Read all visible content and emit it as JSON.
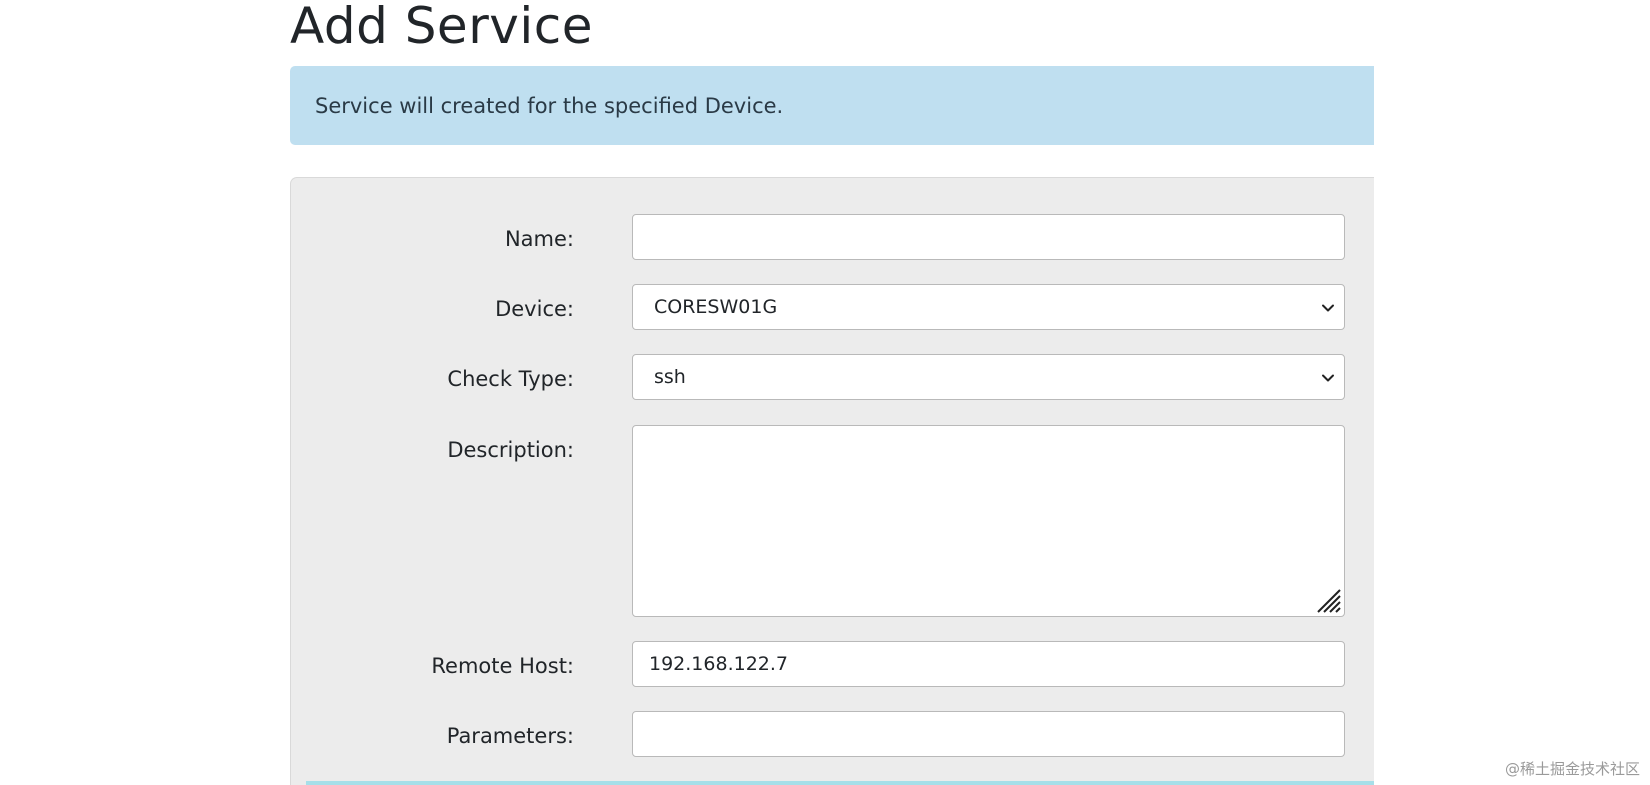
{
  "page": {
    "title": "Add Service",
    "info_message": "Service will created for the specified Device."
  },
  "form": {
    "name": {
      "label": "Name:",
      "value": ""
    },
    "device": {
      "label": "Device:",
      "selected": "CORESW01G"
    },
    "check_type": {
      "label": "Check Type:",
      "selected": "ssh"
    },
    "description": {
      "label": "Description:",
      "value": ""
    },
    "remote_host": {
      "label": "Remote Host:",
      "value": "192.168.122.7"
    },
    "parameters": {
      "label": "Parameters:",
      "value": ""
    }
  },
  "watermark": "@稀土掘金技术社区",
  "colors": {
    "info_background": "#bfdff0",
    "panel_background": "#ececec",
    "bottom_strip": "#a6dfe9"
  },
  "icons": {
    "select_arrow": "chevron-down-icon",
    "textarea_grip": "resize-grip-icon"
  }
}
